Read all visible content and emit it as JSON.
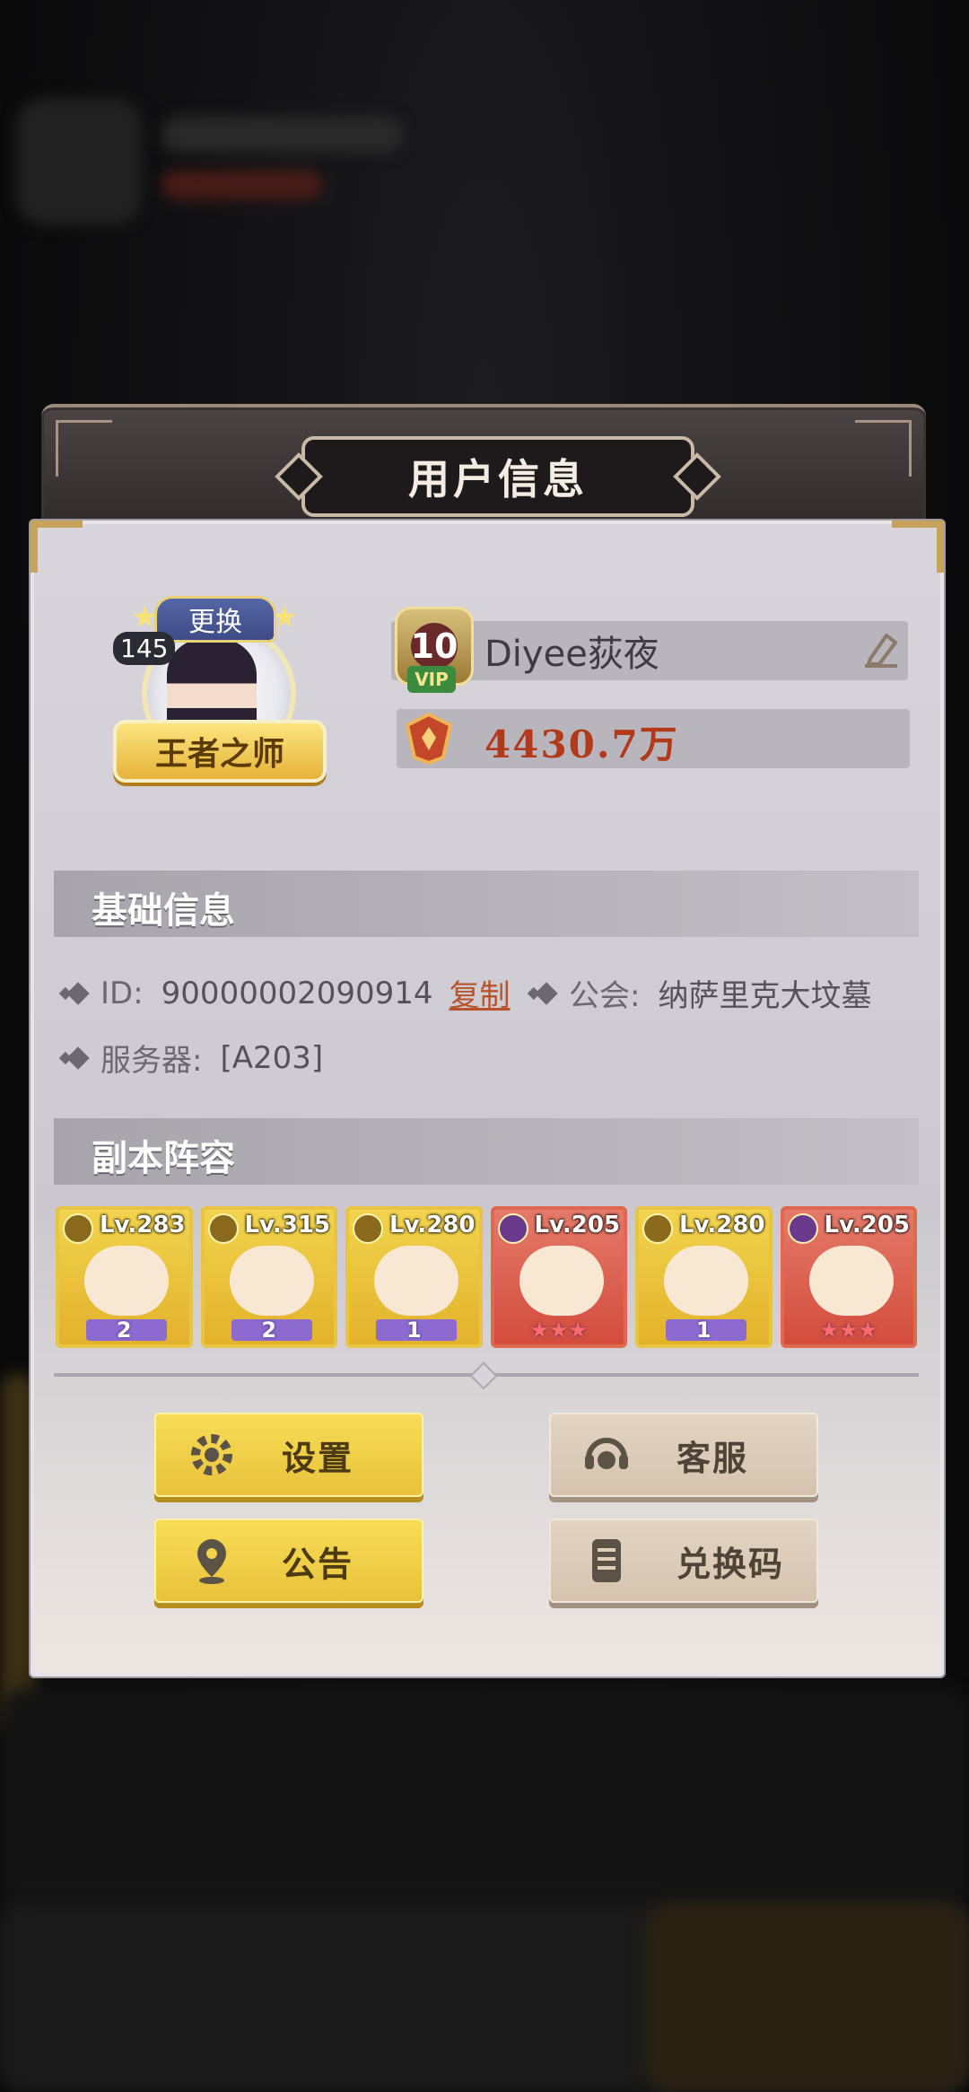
{
  "title": "用户信息",
  "avatar": {
    "level": "145",
    "change_label": "更换",
    "title_badge": "王者之师"
  },
  "player": {
    "vip_level": "10",
    "vip_tag": "VIP",
    "name": "Diyee荻夜",
    "power": "4430.7万"
  },
  "basic_info": {
    "header": "基础信息",
    "id_label": "ID:",
    "id_value": "90000002090914",
    "copy_label": "复制",
    "guild_label": "公会:",
    "guild_value": "纳萨里克大坟墓",
    "server_label": "服务器:",
    "server_value": "[A203]"
  },
  "lineup": {
    "header": "副本阵容",
    "heroes": [
      {
        "level": "Lv.283",
        "stars": "2",
        "frame": "gold"
      },
      {
        "level": "Lv.315",
        "stars": "2",
        "frame": "gold"
      },
      {
        "level": "Lv.280",
        "stars": "1",
        "frame": "gold"
      },
      {
        "level": "Lv.205",
        "stars": "★★★",
        "frame": "red"
      },
      {
        "level": "Lv.280",
        "stars": "1",
        "frame": "gold"
      },
      {
        "level": "Lv.205",
        "stars": "★★★",
        "frame": "red"
      }
    ]
  },
  "buttons": {
    "settings": "设置",
    "customer_service": "客服",
    "announcement": "公告",
    "redeem_code": "兑换码"
  },
  "colors": {
    "accent_yellow": "#f8dd58",
    "power_red": "#b23a1a",
    "copy_link": "#b8532b"
  }
}
